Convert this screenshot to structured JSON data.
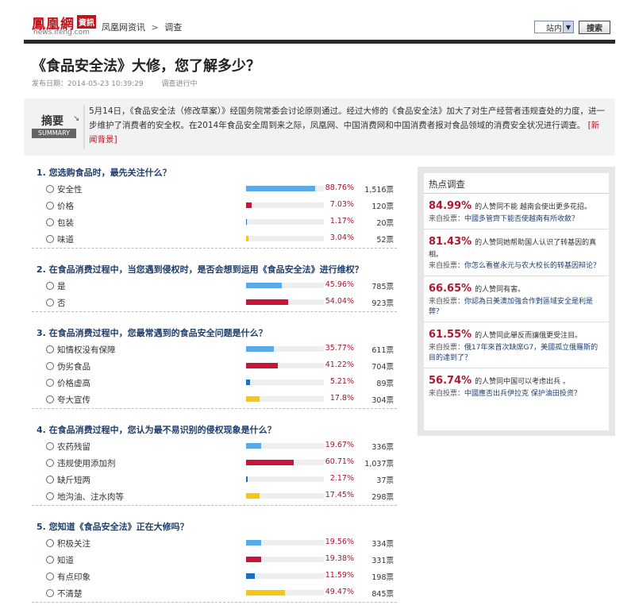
{
  "header": {
    "logo_cn": "鳳凰網",
    "logo_badge": "資訊",
    "logo_en": "news.ifeng.com",
    "breadcrumb": [
      "凤凰网资讯",
      "调查"
    ],
    "breadcrumb_sep": ">",
    "site_select": "站内",
    "search_button": "搜索"
  },
  "article": {
    "title": "《食品安全法》大修，您了解多少？",
    "publish_label": "发布日期：2014-05-23 10:39:29",
    "status": "调查进行中"
  },
  "summary": {
    "badge_zh": "摘要",
    "badge_en": "SUMMARY",
    "text": "5月14日，《食品安全法（修改草案）》经国务院常委会讨论原则通过。经过大修的《食品安全法》加大了对生产经营者违规查处的力度，进一步维护了消费者的安全权。在2014年食品安全周到来之际，凤凰网、中国消费网和中国消费者报对食品领域的消费安全状况进行调查。",
    "more_link": "[新闻背景]"
  },
  "colors": {
    "blue": "#5aaae6",
    "red": "#c8163a",
    "blue_dark": "#1f6fbf",
    "yellow": "#f5c518"
  },
  "questions": [
    {
      "title": "1. 您选购食品时，最先关注什么？",
      "options": [
        {
          "label": "安全性",
          "pct": "88.76%",
          "votes": "1,516票",
          "value": 88.76,
          "color": "blue"
        },
        {
          "label": "价格",
          "pct": "7.03%",
          "votes": "120票",
          "value": 7.03,
          "color": "red"
        },
        {
          "label": "包装",
          "pct": "1.17%",
          "votes": "20票",
          "value": 1.17,
          "color": "blue_dark"
        },
        {
          "label": "味道",
          "pct": "3.04%",
          "votes": "52票",
          "value": 3.04,
          "color": "yellow"
        }
      ]
    },
    {
      "title": "2. 在食品消费过程中，当您遇到侵权时，是否会想到运用《食品安全法》进行维权？",
      "options": [
        {
          "label": "是",
          "pct": "45.96%",
          "votes": "785票",
          "value": 45.96,
          "color": "blue"
        },
        {
          "label": "否",
          "pct": "54.04%",
          "votes": "923票",
          "value": 54.04,
          "color": "red"
        }
      ]
    },
    {
      "title": "3. 在食品消费过程中，您最常遇到的食品安全问题是什么？",
      "options": [
        {
          "label": "知情权没有保障",
          "pct": "35.77%",
          "votes": "611票",
          "value": 35.77,
          "color": "blue"
        },
        {
          "label": "伪劣食品",
          "pct": "41.22%",
          "votes": "704票",
          "value": 41.22,
          "color": "red"
        },
        {
          "label": "价格虚高",
          "pct": "5.21%",
          "votes": "89票",
          "value": 5.21,
          "color": "blue_dark"
        },
        {
          "label": "夸大宣传",
          "pct": "17.8%",
          "votes": "304票",
          "value": 17.8,
          "color": "yellow"
        }
      ]
    },
    {
      "title": "4. 在食品消费过程中，您认为最不易识别的侵权现象是什么？",
      "options": [
        {
          "label": "农药残留",
          "pct": "19.67%",
          "votes": "336票",
          "value": 19.67,
          "color": "blue"
        },
        {
          "label": "违规使用添加剂",
          "pct": "60.71%",
          "votes": "1,037票",
          "value": 60.71,
          "color": "red"
        },
        {
          "label": "缺斤短两",
          "pct": "2.17%",
          "votes": "37票",
          "value": 2.17,
          "color": "blue_dark"
        },
        {
          "label": "地沟油、注水肉等",
          "pct": "17.45%",
          "votes": "298票",
          "value": 17.45,
          "color": "yellow"
        }
      ]
    },
    {
      "title": "5. 您知道《食品安全法》正在大修吗？",
      "options": [
        {
          "label": "积极关注",
          "pct": "19.56%",
          "votes": "334票",
          "value": 19.56,
          "color": "blue"
        },
        {
          "label": "知道",
          "pct": "19.38%",
          "votes": "331票",
          "value": 19.38,
          "color": "red"
        },
        {
          "label": "有点印象",
          "pct": "11.59%",
          "votes": "198票",
          "value": 11.59,
          "color": "blue_dark"
        },
        {
          "label": "不清楚",
          "pct": "49.47%",
          "votes": "845票",
          "value": 49.47,
          "color": "yellow"
        }
      ]
    }
  ],
  "sidebar": {
    "title": "热点调查",
    "source_label": "来自投票：",
    "items": [
      {
        "pct": "84.99%",
        "desc": "的人赞同不能 越南会使出更多花招。",
        "link": "中國多管齊下能否使越南有所收斂？"
      },
      {
        "pct": "81.43%",
        "desc": "的人赞同她帮助国人认识了转基因的真相。",
        "link": "你怎么看崔永元与农大校长的转基因辩论？"
      },
      {
        "pct": "66.65%",
        "desc": "的人赞同有害。",
        "link": "你認為日美澳加強合作對區域安全是利是弊？"
      },
      {
        "pct": "61.55%",
        "desc": "的人赞同此舉反而讓俄更受注目。",
        "link": "俄17年來首次缺席G7，美國孤立俄羅斯的目的達到了？"
      },
      {
        "pct": "56.74%",
        "desc": "的人赞同中国可以考虑出兵 。",
        "link": "中國應否出兵伊拉克 保护油田投资？"
      }
    ]
  }
}
